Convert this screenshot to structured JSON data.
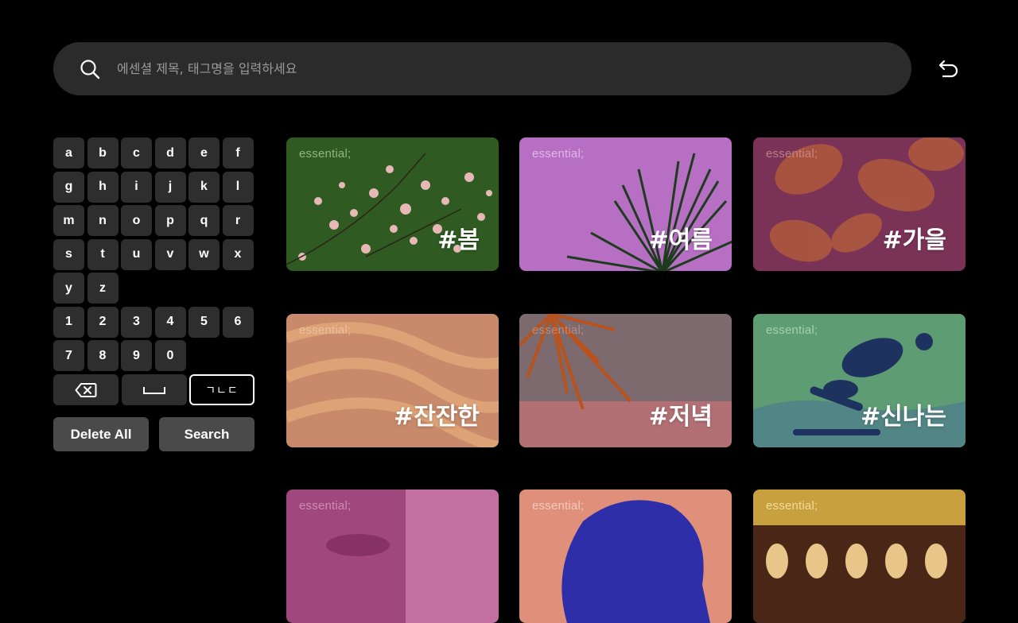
{
  "search": {
    "placeholder": "에센셜 제목, 태그명을 입력하세요"
  },
  "keyboard": {
    "rows": [
      [
        "a",
        "b",
        "c",
        "d",
        "e",
        "f"
      ],
      [
        "g",
        "h",
        "i",
        "j",
        "k",
        "l"
      ],
      [
        "m",
        "n",
        "o",
        "p",
        "q",
        "r"
      ],
      [
        "s",
        "t",
        "u",
        "v",
        "w",
        "x"
      ],
      [
        "y",
        "z"
      ],
      [
        "1",
        "2",
        "3",
        "4",
        "5",
        "6"
      ],
      [
        "7",
        "8",
        "9",
        "0"
      ]
    ],
    "language_toggle": "ㄱㄴㄷ",
    "delete_all": "Delete All",
    "search_button": "Search"
  },
  "cards": [
    {
      "brand": "essential;",
      "tag": "#봄",
      "bg": "#2f5a22",
      "brand_color": "#b9d9a4"
    },
    {
      "brand": "essential;",
      "tag": "#여름",
      "bg": "#b76fc4",
      "brand_color": "#f1d2f6"
    },
    {
      "brand": "essential;",
      "tag": "#가을",
      "bg": "#7a3357",
      "brand_color": "#d49a9a"
    },
    {
      "brand": "essential;",
      "tag": "#잔잔한",
      "bg": "#c98a6b",
      "brand_color": "#f3c9b0"
    },
    {
      "brand": "essential;",
      "tag": "#저녁",
      "bg": "#7c6a6e",
      "brand_color": "#c99a8a"
    },
    {
      "brand": "essential;",
      "tag": "#신나는",
      "bg": "#5e9d73",
      "brand_color": "#bde3c3"
    },
    {
      "brand": "essential;",
      "tag": "",
      "bg": "#a0487e",
      "brand_color": "#e2a8c7"
    },
    {
      "brand": "essential;",
      "tag": "",
      "bg": "#e0907a",
      "brand_color": "#fbe0d6"
    },
    {
      "brand": "essential;",
      "tag": "",
      "bg": "#c8a03e",
      "brand_color": "#fff2c4"
    }
  ]
}
